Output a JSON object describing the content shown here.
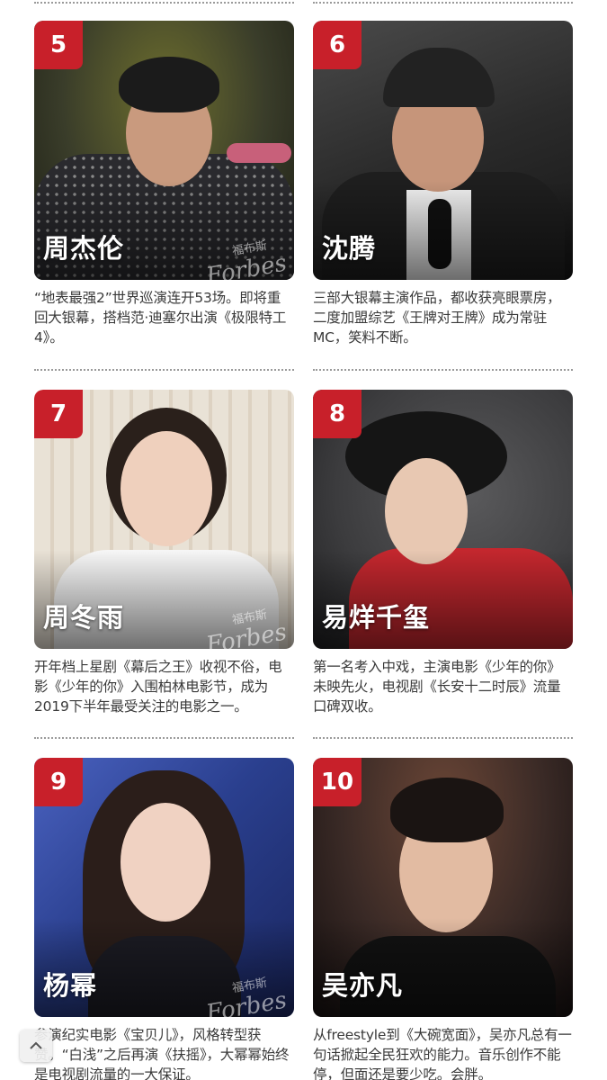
{
  "watermark": {
    "cn": "福布斯",
    "en": "Forbes"
  },
  "cards": [
    {
      "rank": "5",
      "name": "周杰伦",
      "desc": "“地表最强2”世界巡演连开53场。即将重回大银幕，搭档范·迪塞尔出演《极限特工4》。",
      "bg": "#3a3d2a",
      "accent": "#6e6f2e",
      "body": "#2a2a2e",
      "skin": "#c99a7e",
      "hair": "#1b1b1b"
    },
    {
      "rank": "6",
      "name": "沈腾",
      "desc": "三部大银幕主演作品，都收获亮眼票房，二度加盟综艺《王牌对王牌》成为常驻MC，笑料不断。",
      "bg": "#2b2b2b",
      "accent": "#4a4a4a",
      "body": "#1e1e1e",
      "skin": "#c6957a",
      "hair": "#222222"
    },
    {
      "rank": "7",
      "name": "周冬雨",
      "desc": "开年档上星剧《幕后之王》收视不俗，电影《少年的你》入围柏林电影节，成为2019下半年最受关注的电影之一。",
      "bg": "#e6ddd0",
      "accent": "#f2ede6",
      "body": "#f5f5f5",
      "skin": "#efd0bd",
      "hair": "#2a201b"
    },
    {
      "rank": "8",
      "name": "易烊千玺",
      "desc": "第一名考入中戏，主演电影《少年的你》未映先火，电视剧《长安十二时辰》流量口碑双收。",
      "bg": "#3c3c3e",
      "accent": "#5a5a5c",
      "body": "#c4272e",
      "skin": "#e8c8b2",
      "hair": "#151515"
    },
    {
      "rank": "9",
      "name": "杨幂",
      "desc": "参演纪实电影《宝贝儿》，风格转型获赞。“白浅”之后再演《扶摇》，大幂幂始终是电视剧流量的一大保证。",
      "bg": "#2a3f8e",
      "accent": "#4a62c0",
      "body": "#1c1c24",
      "skin": "#f0d2c2",
      "hair": "#2b1e1a"
    },
    {
      "rank": "10",
      "name": "吴亦凡",
      "desc": "从freestyle到《大碗宽面》，吴亦凡总有一句话掀起全民狂欢的能力。音乐创作不能停，但面还是要少吃。会胖。",
      "bg": "#3a2a26",
      "accent": "#6b4636",
      "body": "#121212",
      "skin": "#e2bba2",
      "hair": "#1a1412"
    }
  ]
}
